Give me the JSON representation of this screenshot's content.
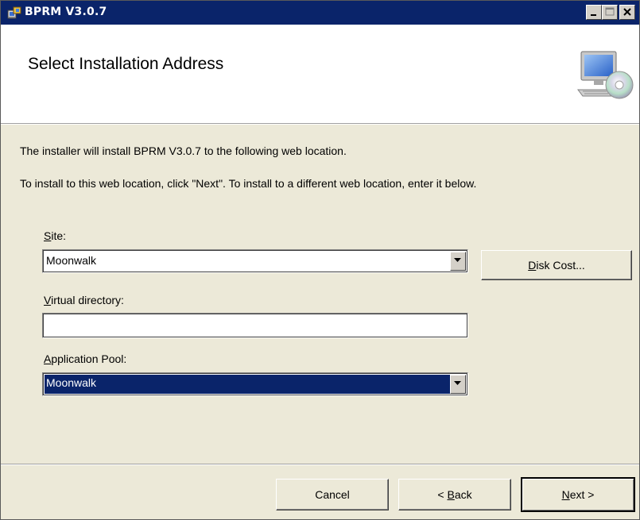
{
  "window": {
    "title": "BPRM V3.0.7"
  },
  "banner": {
    "heading": "Select Installation Address",
    "icon": "computer-cd-icon"
  },
  "body": {
    "description_1": "The installer will install BPRM V3.0.7 to the following web location.",
    "description_2": "To install to this web location, click \"Next\". To install to a different web location, enter it below."
  },
  "site": {
    "label_mnemonic": "S",
    "label_rest": "ite:",
    "value": "Moonwalk"
  },
  "disk_cost": {
    "label_mnemonic": "D",
    "label_rest": "isk Cost..."
  },
  "virtual_directory": {
    "label_mnemonic": "V",
    "label_rest": "irtual directory:",
    "value": ""
  },
  "application_pool": {
    "label_mnemonic": "A",
    "label_rest": "pplication Pool:",
    "value": "Moonwalk"
  },
  "footer": {
    "cancel_label": "Cancel",
    "back_prefix": "< ",
    "back_mnemonic": "B",
    "back_rest": "ack",
    "next_mnemonic": "N",
    "next_rest": "ext >"
  },
  "colors": {
    "title_bar": "#0a246a",
    "dialog_bg": "#ece9d8",
    "selection": "#0a246a"
  }
}
